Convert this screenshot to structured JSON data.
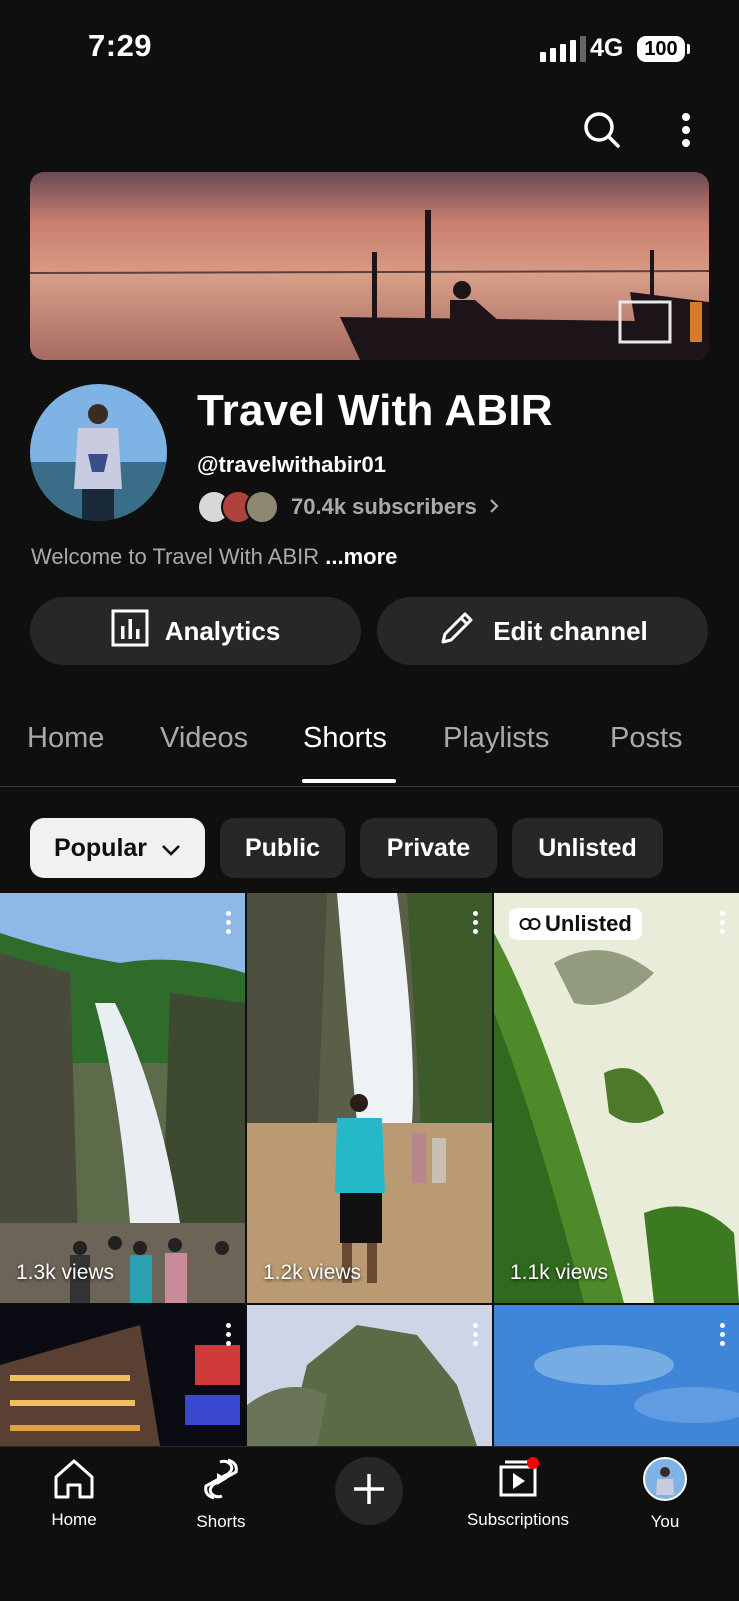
{
  "status": {
    "time": "7:29",
    "network": "4G",
    "battery": "100"
  },
  "channel": {
    "name": "Travel With ABIR",
    "handle": "@travelwithabir01",
    "subscribers": "70.4k subscribers",
    "description": "Welcome to Travel With ABIR",
    "more": "...more"
  },
  "actions": {
    "analytics": "Analytics",
    "edit": "Edit channel"
  },
  "tabs": [
    "Home",
    "Videos",
    "Shorts",
    "Playlists",
    "Posts"
  ],
  "active_tab": "Shorts",
  "filters": [
    "Popular",
    "Public",
    "Private",
    "Unlisted"
  ],
  "shorts": [
    {
      "views": "1.3k views",
      "badge": ""
    },
    {
      "views": "1.2k views",
      "badge": ""
    },
    {
      "views": "1.1k views",
      "badge": "Unlisted"
    },
    {
      "views": "",
      "badge": ""
    },
    {
      "views": "",
      "badge": ""
    },
    {
      "views": "",
      "badge": ""
    }
  ],
  "nav": {
    "home": "Home",
    "shorts": "Shorts",
    "subscriptions": "Subscriptions",
    "you": "You"
  },
  "icons": {
    "search": "search-icon",
    "more": "more-vert-icon",
    "analytics": "bar-chart-icon",
    "edit": "pencil-icon",
    "dropdown": "chevron-down-icon",
    "link": "link-icon",
    "home": "home-icon",
    "shorts": "shorts-icon",
    "create": "plus-icon",
    "subscriptions": "subscriptions-icon"
  },
  "colors": {
    "background": "#0f0f0f",
    "surface": "#272727",
    "chip_selected": "#f1f1f1",
    "notification": "#ff0000"
  }
}
